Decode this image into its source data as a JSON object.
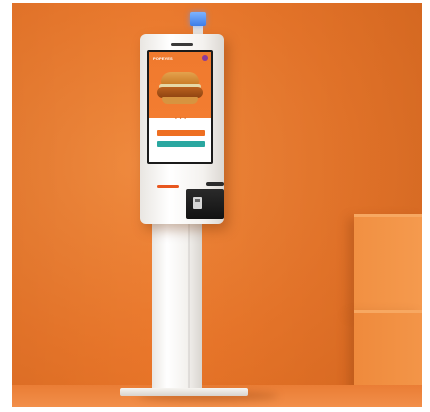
{
  "scene": {
    "background_color": "#e9762a",
    "kiosk_body_color": "#f4f2ef",
    "beacon_color": "#3d7de8"
  },
  "kiosk_screen": {
    "brand": "POPEYES",
    "primary_button_color": "#ee6f22",
    "secondary_button_color": "#2aa7a0",
    "carousel_indicator": "● ● ●"
  }
}
